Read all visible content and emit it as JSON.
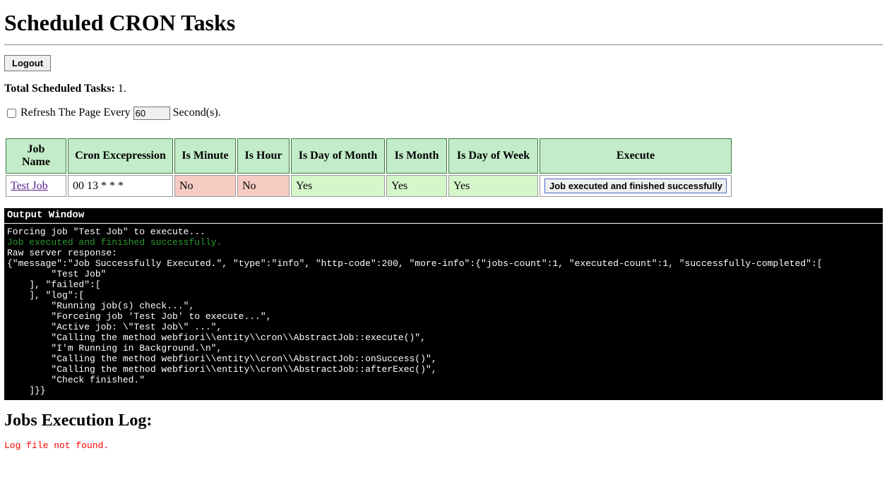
{
  "page_title": "Scheduled CRON Tasks",
  "logout_label": "Logout",
  "total_label": "Total Scheduled Tasks:",
  "total_value": "1.",
  "refresh_label_before": "Refresh The Page Every",
  "refresh_value": "60",
  "refresh_label_after": "Second(s).",
  "table_headers": {
    "job_name": "Job Name",
    "cron": "Cron Excepression",
    "is_minute": "Is Minute",
    "is_hour": "Is Hour",
    "is_dom": "Is Day of Month",
    "is_month": "Is Month",
    "is_dow": "Is Day of Week",
    "execute": "Execute"
  },
  "job_row": {
    "name": "Test Job",
    "cron": "00 13 * * *",
    "is_minute": "No",
    "is_hour": "No",
    "is_dom": "Yes",
    "is_month": "Yes",
    "is_dow": "Yes",
    "execute_label": "Job executed and finished successfully"
  },
  "output_title": "Output Window",
  "output_line1": "Forcing job \"Test Job\" to execute...",
  "output_success": "Job executed and finished successfully.",
  "output_raw_label": "Raw server response:",
  "output_raw_body": "{\"message\":\"Job Successfully Executed.\", \"type\":\"info\", \"http-code\":200, \"more-info\":{\"jobs-count\":1, \"executed-count\":1, \"successfully-completed\":[\n        \"Test Job\"\n    ], \"failed\":[\n    ], \"log\":[\n        \"Running job(s) check...\",\n        \"Forceing job 'Test Job' to execute...\",\n        \"Active job: \\\"Test Job\\\" ...\",\n        \"Calling the method webfiori\\\\entity\\\\cron\\\\AbstractJob::execute()\",\n        \"I'm Running in Background.\\n\",\n        \"Calling the method webfiori\\\\entity\\\\cron\\\\AbstractJob::onSuccess()\",\n        \"Calling the method webfiori\\\\entity\\\\cron\\\\AbstractJob::afterExec()\",\n        \"Check finished.\"\n    ]}}",
  "log_title": "Jobs Execution Log:",
  "log_missing": "Log file not found."
}
